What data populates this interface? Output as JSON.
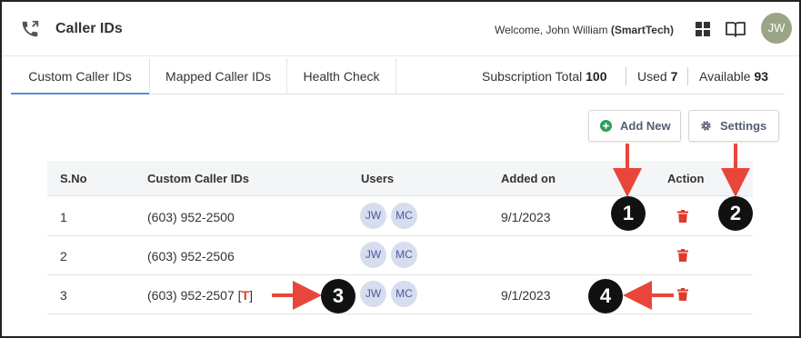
{
  "header": {
    "title": "Caller IDs",
    "welcome_prefix": "Welcome, John William",
    "organization": "(SmartTech)",
    "avatar_initials": "JW"
  },
  "tabs": [
    {
      "label": "Custom Caller IDs",
      "active": true
    },
    {
      "label": "Mapped Caller IDs",
      "active": false
    },
    {
      "label": "Health Check",
      "active": false
    }
  ],
  "subscription": {
    "total_label": "Subscription Total",
    "total_value": "100",
    "used_label": "Used",
    "used_value": "7",
    "available_label": "Available",
    "available_value": "93"
  },
  "toolbar": {
    "add_new_label": "Add New",
    "settings_label": "Settings"
  },
  "table": {
    "columns": [
      "S.No",
      "Custom Caller IDs",
      "Users",
      "Added on",
      "Action"
    ],
    "rows": [
      {
        "sno": "1",
        "caller_id": "(603) 952-2500",
        "tag": "",
        "users": [
          "JW",
          "MC"
        ],
        "added_on": "9/1/2023"
      },
      {
        "sno": "2",
        "caller_id": "(603) 952-2506",
        "tag": "",
        "users": [
          "JW",
          "MC"
        ],
        "added_on": ""
      },
      {
        "sno": "3",
        "caller_id": "(603) 952-2507",
        "tag": "T",
        "users": [
          "JW",
          "MC"
        ],
        "added_on": "9/1/2023"
      }
    ]
  },
  "annotations": [
    "1",
    "2",
    "3",
    "4"
  ],
  "colors": {
    "accent": "#5b8bd6",
    "delete": "#e03a2a",
    "add": "#2e9e5b",
    "avatar": "#9aa585",
    "user_chip": "#d7dcef"
  },
  "icons": [
    "phone-forward-icon",
    "grid-icon",
    "book-icon",
    "plus-circle-icon",
    "gear-icon",
    "trash-icon"
  ]
}
